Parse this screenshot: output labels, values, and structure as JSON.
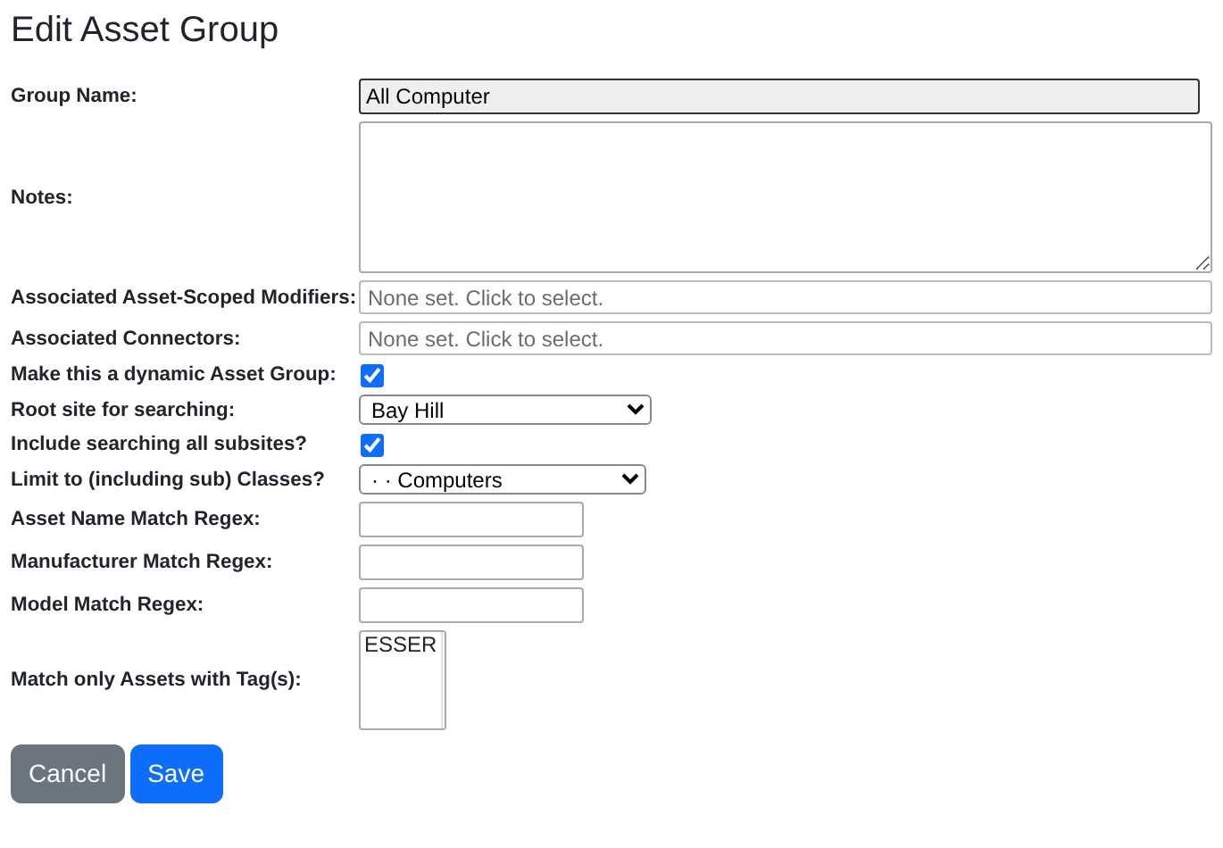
{
  "title": "Edit Asset Group",
  "fields": [
    {
      "label": "Group Name:",
      "kind": "text",
      "value": "All Computer",
      "readonly": true
    },
    {
      "label": "Notes:",
      "kind": "textarea"
    },
    {
      "label": "Associated Asset-Scoped Modifiers:",
      "kind": "picker",
      "placeholder": "None set. Click to select."
    },
    {
      "label": "Associated Connectors:",
      "kind": "picker",
      "placeholder": "None set. Click to select."
    },
    {
      "label": "Make this a dynamic Asset Group:",
      "kind": "checkbox",
      "checked": true
    },
    {
      "label": "Root site for searching:",
      "kind": "select",
      "value": "Bay Hill"
    },
    {
      "label": "Include searching all subsites?",
      "kind": "checkbox",
      "checked": true
    },
    {
      "label": "Limit to (including sub) Classes?",
      "kind": "select",
      "value": "· · Computers"
    },
    {
      "label": "Asset Name Match Regex:",
      "kind": "text",
      "readonly": false
    },
    {
      "label": "Manufacturer Match Regex:",
      "kind": "text",
      "readonly": false
    },
    {
      "label": "Model Match Regex:",
      "kind": "text",
      "readonly": false
    },
    {
      "label": "Match only Assets with Tag(s):",
      "kind": "listbox",
      "items": [
        {
          "label": "ESSER",
          "selected": false
        }
      ]
    }
  ],
  "buttons": [
    {
      "label": "Cancel",
      "kind": "secondary"
    },
    {
      "label": "Save",
      "kind": "primary"
    }
  ]
}
